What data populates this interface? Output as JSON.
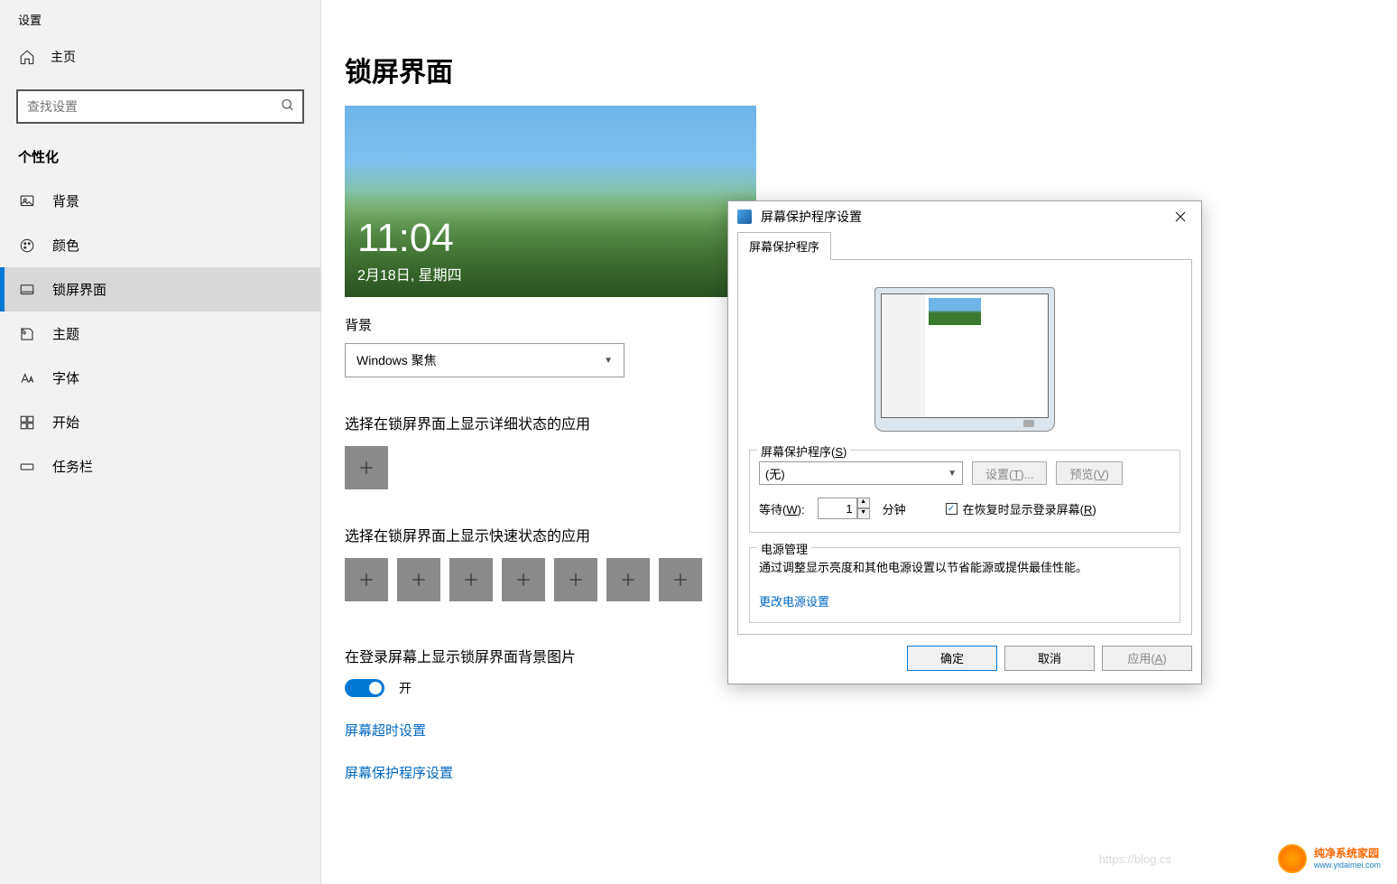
{
  "sidebar": {
    "title": "设置",
    "home": "主页",
    "search_placeholder": "查找设置",
    "section": "个性化",
    "items": [
      {
        "label": "背景"
      },
      {
        "label": "颜色"
      },
      {
        "label": "锁屏界面"
      },
      {
        "label": "主题"
      },
      {
        "label": "字体"
      },
      {
        "label": "开始"
      },
      {
        "label": "任务栏"
      }
    ]
  },
  "main": {
    "title": "锁屏界面",
    "preview_time": "11:04",
    "preview_date": "2月18日, 星期四",
    "bg_label": "背景",
    "bg_value": "Windows 聚焦",
    "detail_label": "选择在锁屏界面上显示详细状态的应用",
    "quick_label": "选择在锁屏界面上显示快速状态的应用",
    "signin_label": "在登录屏幕上显示锁屏界面背景图片",
    "toggle_state": "开",
    "link_timeout": "屏幕超时设置",
    "link_saver": "屏幕保护程序设置"
  },
  "dialog": {
    "title": "屏幕保护程序设置",
    "tab": "屏幕保护程序",
    "saver_legend": "屏幕保护程序(S)",
    "saver_value": "(无)",
    "settings_btn": "设置(T)...",
    "preview_btn": "预览(V)",
    "wait_label": "等待(W):",
    "wait_value": "1",
    "wait_unit": "分钟",
    "resume_label": "在恢复时显示登录屏幕(R)",
    "power_legend": "电源管理",
    "power_text": "通过调整显示亮度和其他电源设置以节省能源或提供最佳性能。",
    "power_link": "更改电源设置",
    "ok": "确定",
    "cancel": "取消",
    "apply": "应用(A)"
  },
  "watermark": {
    "name": "纯净系统家园",
    "url": "www.yidaimei.com"
  },
  "ghost": "https://blog.cs"
}
